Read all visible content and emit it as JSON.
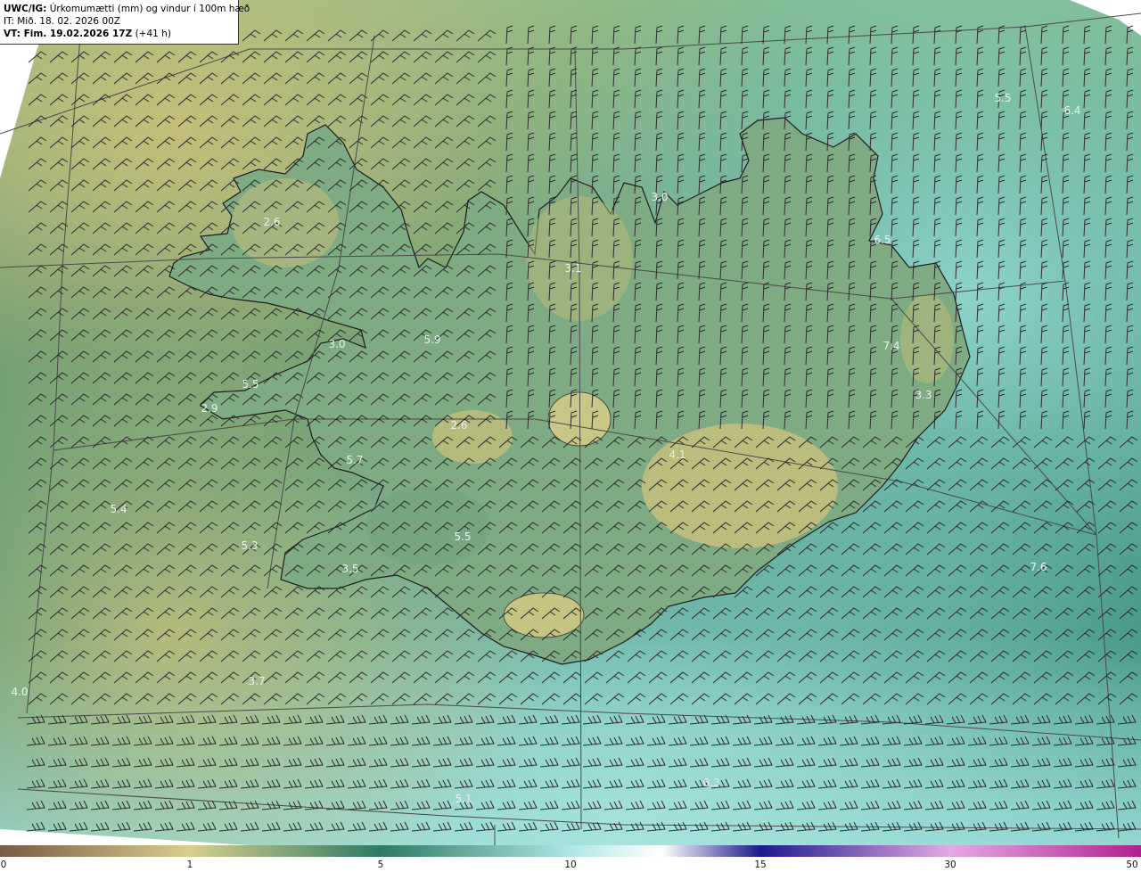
{
  "header": {
    "model": "UWC/IG:",
    "title": "Úrkomumætti (mm) og vindur í 100m hæð",
    "initial_time": "IT: Mið. 18. 02. 2026 00Z",
    "valid_label": "VT: Fim. 19.02.2026 17Z",
    "lead": "(+41 h)"
  },
  "value_labels": [
    {
      "text": "2.6"
    },
    {
      "text": "3.0"
    },
    {
      "text": "5.5"
    },
    {
      "text": "2.9"
    },
    {
      "text": "5.9"
    },
    {
      "text": "3.1"
    },
    {
      "text": "3.0"
    },
    {
      "text": "6.5"
    },
    {
      "text": "7.4"
    },
    {
      "text": "3.3"
    },
    {
      "text": "6.4"
    },
    {
      "text": "5.5"
    },
    {
      "text": "5.7"
    },
    {
      "text": "5.4"
    },
    {
      "text": "5.3"
    },
    {
      "text": "3.5"
    },
    {
      "text": "5.5"
    },
    {
      "text": "2.6"
    },
    {
      "text": "4.1"
    },
    {
      "text": "7.6"
    },
    {
      "text": "4.0"
    },
    {
      "text": "3.7"
    },
    {
      "text": "6.3"
    },
    {
      "text": "5.1"
    }
  ],
  "colorbar": {
    "ticks": [
      "0",
      "1",
      "5",
      "10",
      "15",
      "30",
      "50"
    ],
    "colors": [
      "#7a5a44",
      "#d8cf8e",
      "#2d7a62",
      "#aee6e4",
      "#ffffff",
      "#1a1a8c",
      "#e6a8e6",
      "#b0208e"
    ]
  },
  "style": {
    "ocean_color": "#2a7a6a",
    "land_dry_color": "#c9c77e",
    "land_mid_color": "#7fae88",
    "wet_color": "#7ed2cc",
    "coast_color": "#222222",
    "grid_color": "#4a4a4a",
    "barb_color": "#2b2b2b"
  }
}
